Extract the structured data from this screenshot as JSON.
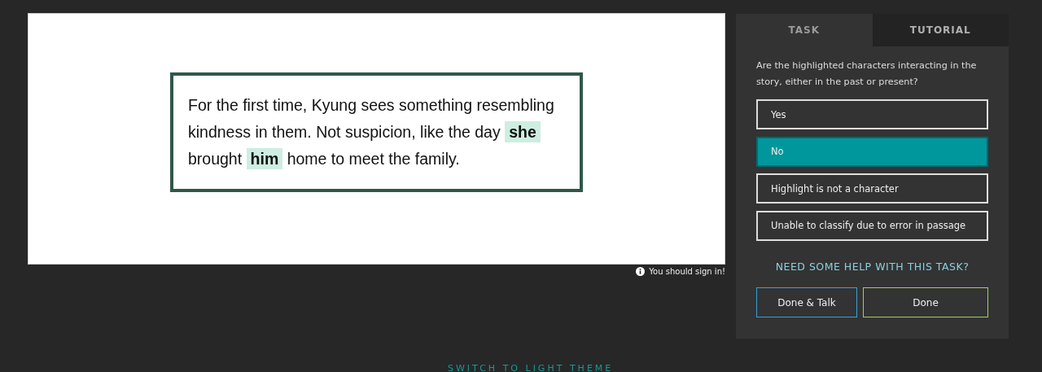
{
  "passage": [
    {
      "kind": "text",
      "text": "For the first time, Kyung sees something resembling kindness in them. Not suspicion, like the day "
    },
    {
      "kind": "highlight",
      "text": "she"
    },
    {
      "kind": "text",
      "text": " brought "
    },
    {
      "kind": "highlight",
      "text": "him"
    },
    {
      "kind": "text",
      "text": " home to meet the family."
    }
  ],
  "notice": "You should sign in!",
  "tabs": [
    {
      "label": "TASK",
      "selected": true
    },
    {
      "label": "TUTORIAL",
      "selected": false
    }
  ],
  "question": "Are the highlighted characters interacting in the story, either in the past or present?",
  "answers": [
    {
      "label": "Yes",
      "selected": false
    },
    {
      "label": "No",
      "selected": true
    },
    {
      "label": "Highlight is not a character",
      "selected": false
    },
    {
      "label": "Unable to classify due to error in passage",
      "selected": false
    }
  ],
  "help_link": "NEED SOME HELP WITH THIS TASK?",
  "buttons": [
    {
      "kind": "talk",
      "label": "Done & Talk"
    },
    {
      "kind": "done",
      "label": "Done"
    }
  ],
  "theme_link": "SWITCH TO LIGHT THEME"
}
